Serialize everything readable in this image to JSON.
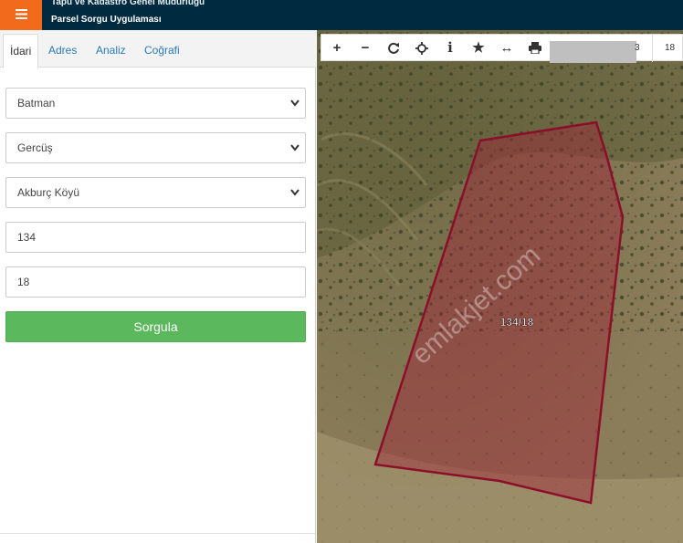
{
  "header": {
    "title_line1": "Tapu ve Kadastro Genel Müdürlüğü",
    "title_line2": "Parsel Sorgu Uygulaması"
  },
  "tabs": [
    {
      "label": "İdari"
    },
    {
      "label": "Adres"
    },
    {
      "label": "Analiz"
    },
    {
      "label": "Coğrafi"
    }
  ],
  "form": {
    "il": "Batman",
    "ilce": "Gercüş",
    "mahalle": "Akburç Köyü",
    "ada": "134",
    "parsel": "18",
    "submit_label": "Sorgula"
  },
  "map": {
    "parcel_label": "134/18",
    "scale_left_fragment": "3",
    "zoom_level": "18",
    "watermark": "emlakjet.com",
    "parcel_color": "#8b0f28"
  }
}
